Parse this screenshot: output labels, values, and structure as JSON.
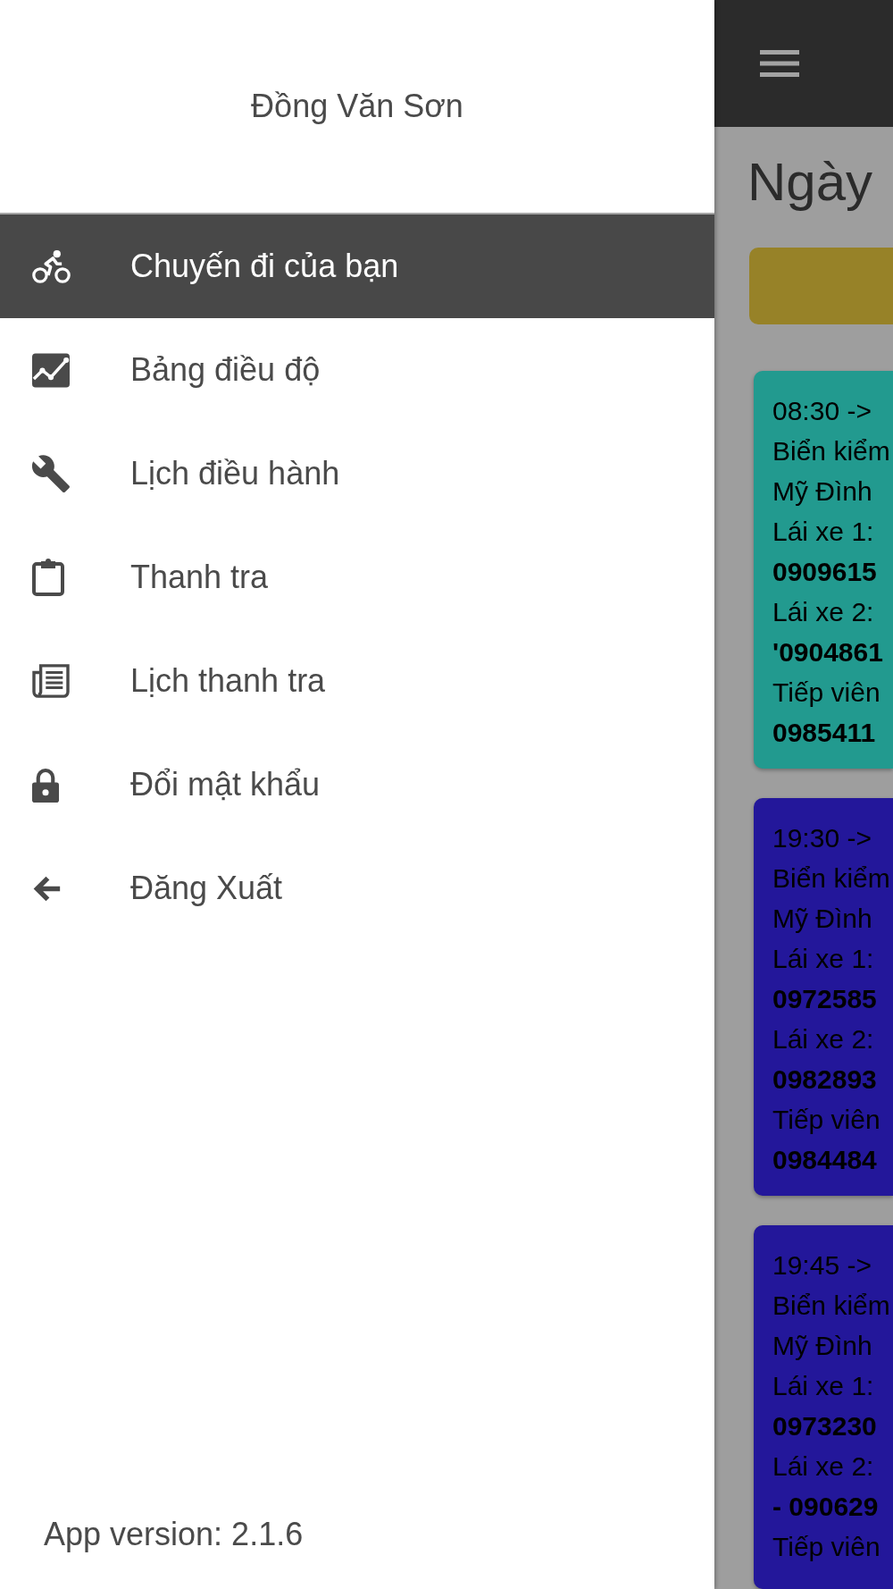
{
  "drawer": {
    "user_name": "Đồng Văn Sơn",
    "menu": [
      {
        "label": "Chuyến đi của bạn",
        "selected": true
      },
      {
        "label": "Bảng điều độ",
        "selected": false
      },
      {
        "label": "Lịch điều hành",
        "selected": false
      },
      {
        "label": "Thanh tra",
        "selected": false
      },
      {
        "label": "Lịch thanh tra",
        "selected": false
      },
      {
        "label": "Đổi mật khẩu",
        "selected": false
      },
      {
        "label": "Đăng Xuất",
        "selected": false
      }
    ],
    "app_version": "App version: 2.1.6"
  },
  "main": {
    "title": "Ngày",
    "trips": [
      {
        "color": "#229a8f",
        "lines": [
          {
            "text": "08:30 ->",
            "bold": false
          },
          {
            "text": "Biển kiểm",
            "bold": false
          },
          {
            "text": "Mỹ Đình",
            "bold": false
          },
          {
            "text": "Lái xe 1:",
            "bold": false
          },
          {
            "text": "0909615",
            "bold": true
          },
          {
            "text": "Lái xe 2:",
            "bold": false
          },
          {
            "text": "'0904861",
            "bold": true
          },
          {
            "text": "Tiếp viên",
            "bold": false
          },
          {
            "text": "0985411",
            "bold": true
          }
        ]
      },
      {
        "color": "#23179a",
        "lines": [
          {
            "text": "19:30 ->",
            "bold": false
          },
          {
            "text": "Biển kiểm",
            "bold": false
          },
          {
            "text": "Mỹ Đình",
            "bold": false
          },
          {
            "text": "Lái xe 1:",
            "bold": false
          },
          {
            "text": "0972585",
            "bold": true
          },
          {
            "text": "Lái xe 2:",
            "bold": false
          },
          {
            "text": "0982893",
            "bold": true
          },
          {
            "text": "Tiếp viên",
            "bold": false
          },
          {
            "text": "0984484",
            "bold": true
          }
        ]
      },
      {
        "color": "#23179a",
        "lines": [
          {
            "text": "19:45 ->",
            "bold": false
          },
          {
            "text": "Biển kiểm",
            "bold": false
          },
          {
            "text": "Mỹ Đình",
            "bold": false
          },
          {
            "text": "Lái xe 1:",
            "bold": false
          },
          {
            "text": "0973230",
            "bold": true
          },
          {
            "text": "Lái xe 2:",
            "bold": false
          },
          {
            "text": "- 090629",
            "bold": true
          },
          {
            "text": "Tiếp viên",
            "bold": false
          }
        ]
      }
    ]
  }
}
